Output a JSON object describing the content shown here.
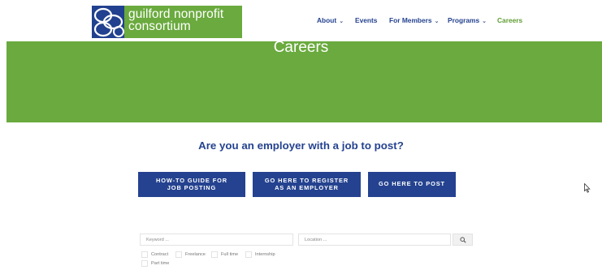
{
  "logo": {
    "line1": "guilford nonprofit",
    "line2": "consortium"
  },
  "nav": {
    "items": [
      {
        "label": "About",
        "dropdown": true
      },
      {
        "label": "Events",
        "dropdown": false
      },
      {
        "label": "For Members",
        "dropdown": true
      },
      {
        "label": "Programs",
        "dropdown": true
      },
      {
        "label": "Careers",
        "dropdown": false,
        "active": true
      }
    ]
  },
  "hero": {
    "title": "Careers"
  },
  "employer": {
    "question": "Are you an employer with a job to post?",
    "buttons": [
      "HOW-TO GUIDE FOR\nJOB POSTING",
      "GO HERE TO REGISTER\nAS AN EMPLOYER",
      "GO HERE TO POST"
    ]
  },
  "search": {
    "keyword_placeholder": "Keyword ...",
    "location_placeholder": "Location ...",
    "filters": [
      "Contract",
      "Freelance",
      "Full time",
      "Internship",
      "Part time"
    ]
  },
  "colors": {
    "brand_blue": "#24428f",
    "brand_green": "#6aaa3e",
    "active_nav": "#5f9c33"
  }
}
